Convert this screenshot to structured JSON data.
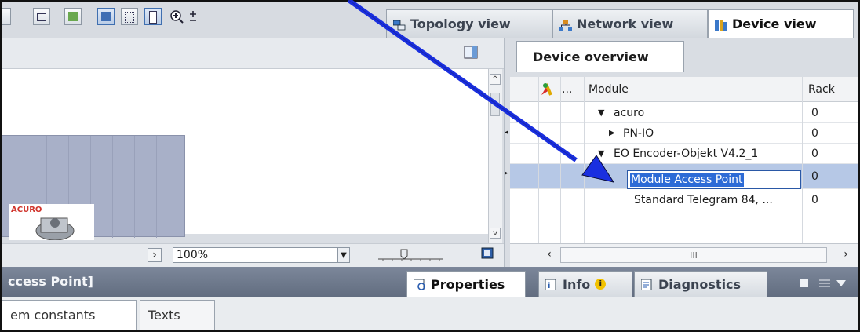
{
  "view_tabs": [
    {
      "label": "Topology view",
      "icon": "topology-icon"
    },
    {
      "label": "Network view",
      "icon": "network-icon"
    },
    {
      "label": "Device view",
      "icon": "device-icon"
    }
  ],
  "editor": {
    "zoom_value": "100%",
    "device_logo_text": "ACURO"
  },
  "device_overview": {
    "tab_label": "Device overview",
    "columns": {
      "dots": "...",
      "module": "Module",
      "rack": "Rack"
    },
    "rows": [
      {
        "module": "acuro",
        "rack": "0",
        "expander": "▼"
      },
      {
        "module": "PN-IO",
        "rack": "0",
        "expander": "▶"
      },
      {
        "module": "EO Encoder-Objekt V4.2_1",
        "rack": "0",
        "expander": "▼"
      },
      {
        "module": "Module Access Point",
        "rack": "0",
        "expander": ""
      },
      {
        "module": "Standard Telegram 84, ...",
        "rack": "0",
        "expander": ""
      }
    ],
    "hscroll_mid": "III"
  },
  "inspector": {
    "title": "ccess Point]",
    "tabs": [
      {
        "label": "Properties",
        "icon": "properties-icon"
      },
      {
        "label": "Info",
        "icon": "info-icon"
      },
      {
        "label": "Diagnostics",
        "icon": "diagnostics-icon"
      }
    ],
    "subtabs": [
      "em constants",
      "Texts"
    ]
  },
  "colors": {
    "accent": "#2d6bd6",
    "arrow": "#1a2fe0",
    "rack": "#a8b0c8",
    "inspector": "#6e798c"
  }
}
